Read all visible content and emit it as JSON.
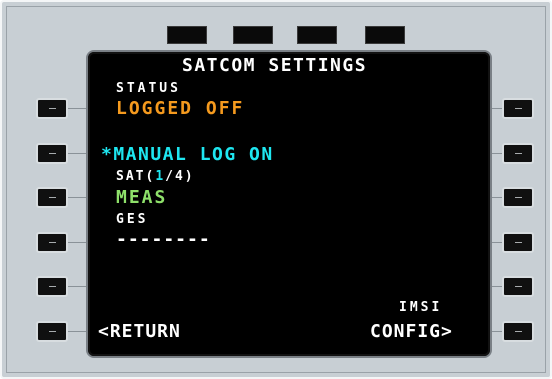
{
  "page": {
    "title": "SATCOM SETTINGS"
  },
  "fields": {
    "status_label": "STATUS",
    "status_value": "LOGGED OFF",
    "manual_logon": "*MANUAL LOG ON",
    "sat_prefix": "SAT(",
    "sat_current": "1",
    "sat_suffix": "/4)",
    "meas": "MEAS",
    "ges_label": "GES",
    "ges_value": "--------"
  },
  "prompts": {
    "return": "<RETURN",
    "imsi_label": "IMSI",
    "config": "CONFIG>"
  },
  "colors": {
    "title": "#ffffff",
    "label": "#ffffff",
    "status_value": "#f59a1e",
    "selectable": "#1ee6f0",
    "active": "#8ee06a"
  }
}
